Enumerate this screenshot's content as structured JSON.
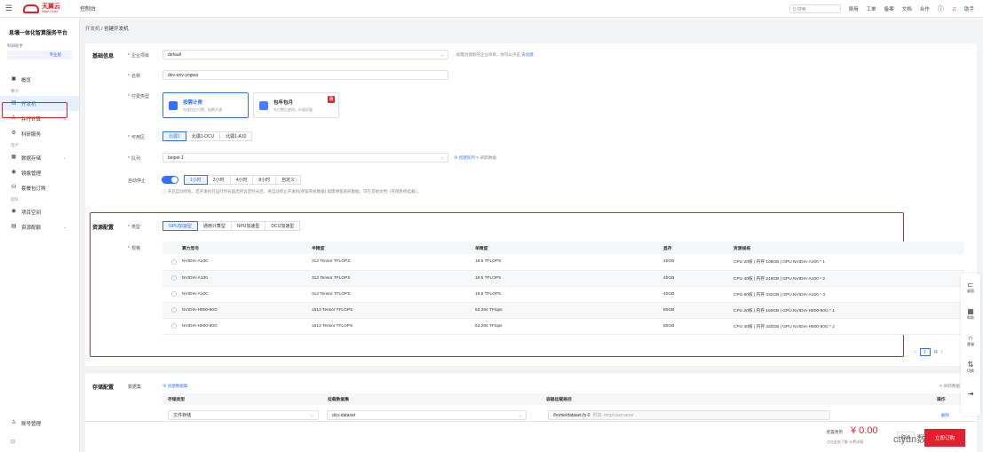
{
  "topbar": {
    "logo_text": "天翼云",
    "logo_sub": "State Cloud",
    "console": "控制台",
    "search_placeholder": "Q 搜索",
    "links": [
      "费用",
      "工单",
      "备案",
      "文档",
      "合作"
    ],
    "user": "助手"
  },
  "sidebar": {
    "platform": "息壤一体化智算服务平台",
    "workspace_label": "科研助手",
    "workspace_value": "专业版",
    "items": [
      {
        "group": "",
        "label": "概览",
        "icon": "overview-icon"
      },
      {
        "group": "算力",
        "label": "",
        "icon": ""
      },
      {
        "group": "",
        "label": "开发机",
        "icon": "dev-machine-icon",
        "active": true
      },
      {
        "group": "",
        "label": "并行计算",
        "icon": "parallel-icon",
        "chevron": true
      },
      {
        "group": "",
        "label": "科研服务",
        "icon": "research-icon"
      },
      {
        "group": "资产",
        "label": "",
        "icon": ""
      },
      {
        "group": "",
        "label": "数据存储",
        "icon": "storage-icon",
        "chevron": true
      },
      {
        "group": "",
        "label": "镜像管理",
        "icon": "image-icon"
      },
      {
        "group": "",
        "label": "套餐包订购",
        "icon": "package-icon"
      },
      {
        "group": "团队",
        "label": "",
        "icon": ""
      },
      {
        "group": "",
        "label": "项目空间",
        "icon": "project-icon"
      },
      {
        "group": "",
        "label": "资源配额",
        "icon": "quota-icon",
        "chevron": true
      }
    ],
    "account": "账号管理"
  },
  "breadcrumb": {
    "parent": "开发机",
    "sep": "/",
    "current": "创建开发机"
  },
  "basic": {
    "title": "基础信息",
    "enterprise_label": "企业项目",
    "enterprise_value": "default",
    "enterprise_hint": "如需创建新的企业项目，你可以点击",
    "enterprise_link": "去创建",
    "name_label": "名称",
    "name_value": "dev-env-yogwa",
    "billing_label": "付费类型",
    "billing": [
      {
        "title": "按需计费",
        "sub": "先使用后付费，按需开通",
        "selected": true
      },
      {
        "title": "包年包月",
        "sub": "先付费后使用，价格优惠",
        "badge": "惠"
      }
    ],
    "zone_label": "可用区",
    "zones": [
      "北疆1",
      "北疆1-DCU",
      "北疆1-A10"
    ],
    "queue_label": "队列",
    "queue_value": "beipei-1",
    "queue_create": "创建队列",
    "queue_refresh": "刷新数据",
    "autostop_label": "自动停止",
    "autostop_options": [
      "1小时",
      "2小时",
      "4小时",
      "8小时",
      "自定义"
    ],
    "autostop_hint": "开启自动停机，若开发机在运行时长超出所设定时长后，将自动停止开发机(保留系统数据) 如需保留系统数据，可在其他文档（存储系统挂载）。"
  },
  "resource": {
    "title": "资源配置",
    "type_label": "类型",
    "types": [
      "GPU加速型",
      "通用计算型",
      "NPU加速型",
      "DCU加速型"
    ],
    "spec_label": "规格",
    "columns": [
      "算力型号",
      "半精度",
      "单精度",
      "显存",
      "资源规格"
    ],
    "rows": [
      [
        "NVIDIA-A100",
        "312 Tensor TFLOPS",
        "19.5 TFLOPS",
        "40GB",
        "CPU 20核 | 内存 108GB | GPU NVIDIA-A100 * 1"
      ],
      [
        "NVIDIA-A100",
        "312 Tensor TFLOPS",
        "19.5 TFLOPS",
        "40GB",
        "CPU 40核 | 内存 216GB | GPU NVIDIA-A100 * 2"
      ],
      [
        "NVIDIA-A100",
        "312 Tensor TFLOPS",
        "19.5 TFLOPS",
        "40GB",
        "CPU 80核 | 内存 432GB | GPU NVIDIA-A100 * 4"
      ],
      [
        "NVIDIA-H800-80G",
        "1513 Tensor TFLOPS",
        "53.284 TFlops",
        "80GB",
        "CPU 20核 | 内存 160GB | GPU NVIDIA-H800-80G * 1"
      ],
      [
        "NVIDIA-H800-80G",
        "1513 Tensor TFLOPS",
        "53.284 TFlops",
        "80GB",
        "CPU 40核 | 内存 320GB | GPU NVIDIA-H800-80G * 2"
      ]
    ],
    "page_current": "1",
    "page_total": "/4"
  },
  "storage": {
    "title": "存储配置",
    "dataset_label": "数据集",
    "add_dataset": "创建数据集",
    "refresh": "刷新数据",
    "columns": [
      "存储类型",
      "挂载数据集",
      "容器挂载路径",
      "操作"
    ],
    "row": {
      "type": "文件存储",
      "dataset": "dcu-dataset",
      "path": "/home/dataset.fs-0",
      "path_hint": "例如: /tmp/username",
      "action": "删除"
    }
  },
  "footer": {
    "fee_label": "配置费用",
    "fee_value": "¥ 0.00",
    "fee_sub": "点击此处了解 计费详情",
    "cancel": "取消",
    "submit": "立即订购",
    "watermark": "ctyun数"
  },
  "float_bar": [
    "桌面",
    "帮助",
    "客服",
    "切换"
  ]
}
